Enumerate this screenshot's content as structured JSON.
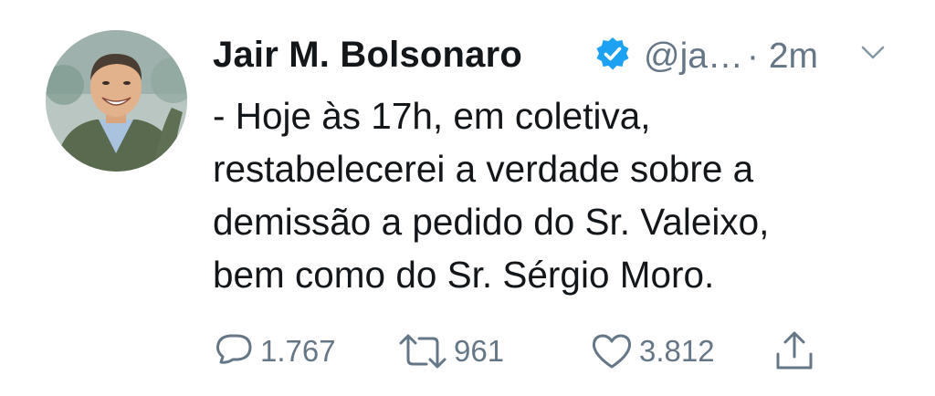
{
  "tweet": {
    "author": {
      "name": "Jair M. Bolsonaro",
      "handle": "@ja…",
      "verified": true,
      "avatar": "profile-photo"
    },
    "separator": "·",
    "time": "2m",
    "text": "- Hoje às 17h, em coletiva,\nrestabelecerei a verdade sobre a\ndemissão a pedido do Sr. Valeixo,\nbem como do Sr. Sérgio Moro.",
    "actions": {
      "reply_count": "1.767",
      "retweet_count": "961",
      "like_count": "3.812"
    }
  },
  "icons": {
    "verified": "verified-badge-icon",
    "caret": "chevron-down-icon",
    "reply": "reply-icon",
    "retweet": "retweet-icon",
    "like": "heart-icon",
    "share": "share-icon"
  },
  "colors": {
    "text": "#14171a",
    "muted": "#657786",
    "verified": "#1da1f2"
  }
}
